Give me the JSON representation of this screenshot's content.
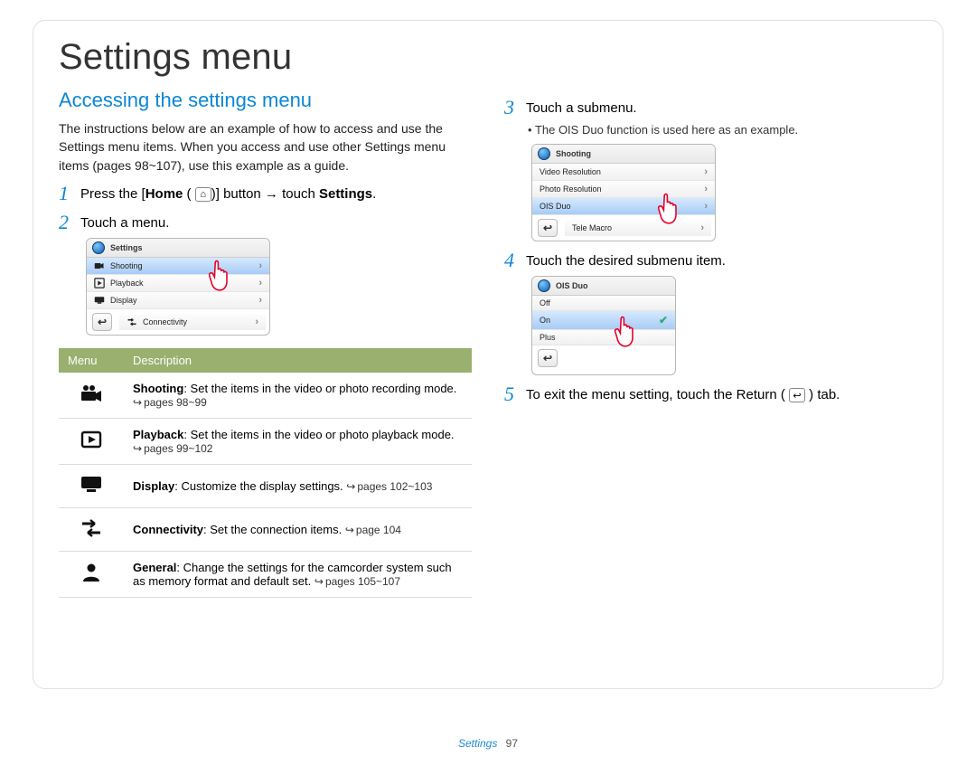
{
  "page": {
    "title": "Settings menu",
    "section_label": "Settings",
    "page_number": "97"
  },
  "section": {
    "heading": "Accessing the settings menu",
    "intro": "The instructions below are an example of how to access and use the Settings menu items. When you access and use other Settings menu items (pages 98~107), use this example as a guide."
  },
  "steps": {
    "s1": {
      "num": "1",
      "pre": "Press the [",
      "home": "Home",
      "mid": " ( ",
      "btn": "⌂",
      "post": ")] button → touch ",
      "settings": "Settings",
      "end": "."
    },
    "s2": {
      "num": "2",
      "text": "Touch a menu."
    },
    "s3": {
      "num": "3",
      "text": "Touch a submenu."
    },
    "s3_note": "The OIS Duo function is used here as an example.",
    "s4": {
      "num": "4",
      "text": "Touch the desired submenu item."
    },
    "s5": {
      "num": "5",
      "pre": "To exit the menu setting, touch the Return ( ",
      "btn": "↩",
      "post": " ) tab."
    }
  },
  "shot_a": {
    "header": "Settings",
    "rows": [
      {
        "label": "Shooting",
        "highlight": true
      },
      {
        "label": "Playback",
        "highlight": false
      },
      {
        "label": "Display",
        "highlight": false
      },
      {
        "label": "Connectivity",
        "highlight": false
      }
    ]
  },
  "shot_b": {
    "header": "Shooting",
    "rows": [
      {
        "label": "Video Resolution",
        "highlight": false
      },
      {
        "label": "Photo Resolution",
        "highlight": false
      },
      {
        "label": "OIS Duo",
        "highlight": true
      },
      {
        "label": "Tele Macro",
        "highlight": false
      }
    ]
  },
  "shot_c": {
    "header": "OIS Duo",
    "rows": [
      {
        "label": "Off",
        "highlight": false,
        "check": false
      },
      {
        "label": "On",
        "highlight": true,
        "check": true
      },
      {
        "label": "Plus",
        "highlight": false,
        "check": false
      }
    ]
  },
  "table": {
    "head_menu": "Menu",
    "head_desc": "Description",
    "rows": [
      {
        "icon": "camcorder",
        "name": "Shooting",
        "desc": ": Set the items in the video or photo recording mode.",
        "pages": "pages 98~99"
      },
      {
        "icon": "play",
        "name": "Playback",
        "desc": ": Set the items in the video or photo playback mode.",
        "pages": "pages 99~102"
      },
      {
        "icon": "display",
        "name": "Display",
        "desc": ": Customize the display settings. ",
        "pages": "pages 102~103"
      },
      {
        "icon": "connectivity",
        "name": "Connectivity",
        "desc": ": Set the connection items. ",
        "pages": "page 104"
      },
      {
        "icon": "person",
        "name": "General",
        "desc": ": Change the settings for the camcorder system such as memory format and default set. ",
        "pages": "pages 105~107"
      }
    ]
  }
}
